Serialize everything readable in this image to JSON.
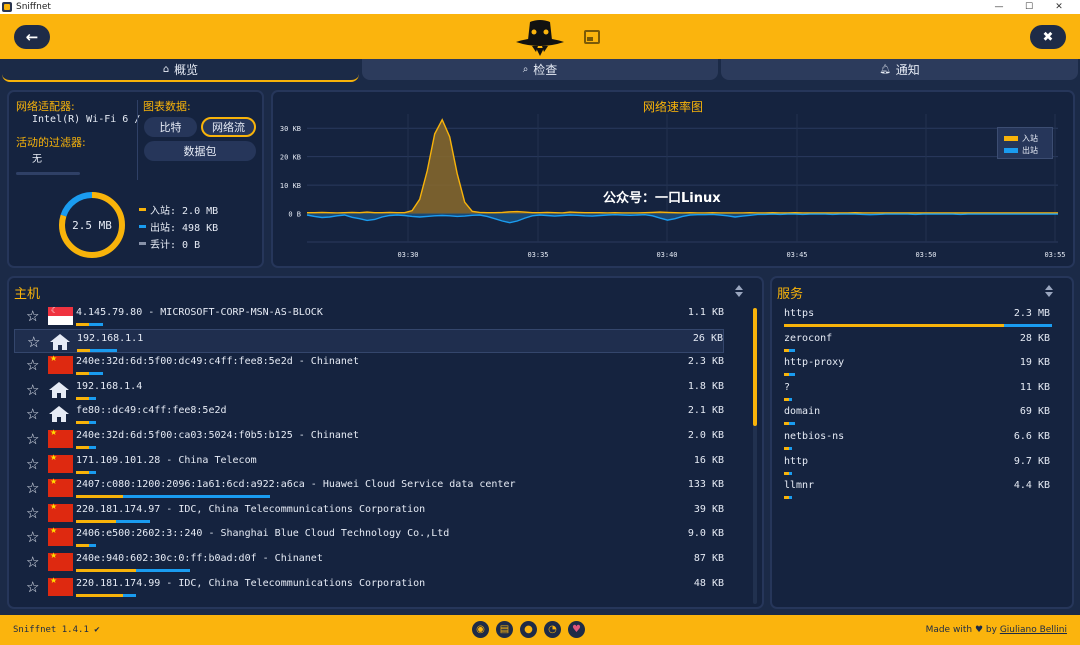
{
  "window": {
    "title": "Sniffnet",
    "controls": [
      "—",
      "☐",
      "✕"
    ]
  },
  "tabs": [
    {
      "label": "概览",
      "icon": "house-icon"
    },
    {
      "label": "检查",
      "icon": "search-icon"
    },
    {
      "label": "通知",
      "icon": "bell-icon"
    }
  ],
  "overview": {
    "adapter_label": "网络适配器:",
    "adapter_value": "Intel(R) Wi-Fi 6 /",
    "filter_label": "活动的过滤器:",
    "filter_value": "无",
    "chart_data_label": "图表数据:",
    "btn_bits": "比特",
    "btn_traffic": "网络流",
    "btn_packets": "数据包",
    "donut_total": "2.5 MB",
    "legend_in": "入站: 2.0 MB",
    "legend_out": "出站: 498 KB",
    "legend_dropped": "丢计: 0 B",
    "donut_fraction_in": 0.8
  },
  "chart_data": {
    "type": "area",
    "title": "网络速率图",
    "x_ticks": [
      "03:30",
      "03:35",
      "03:40",
      "03:45",
      "03:50",
      "03:55"
    ],
    "y_ticks": [
      "30 KB",
      "20 KB",
      "10 KB",
      "0 B"
    ],
    "ylim": [
      -10,
      35
    ],
    "series": [
      {
        "name": "入站",
        "color": "#f8b30a",
        "values": [
          0.3,
          0.3,
          0.4,
          0.3,
          0.2,
          0.3,
          0.4,
          0.3,
          0.5,
          0.3,
          0.3,
          0.4,
          0.3,
          0.3,
          1,
          5,
          15,
          28,
          33,
          27,
          14,
          4,
          0.8,
          0.4,
          0.3,
          0.3,
          0.4,
          0.6,
          0.7,
          0.5,
          0.3,
          0.3,
          0.4,
          0.3,
          0.2,
          0.5,
          0.4,
          0.3,
          0.3,
          0.3,
          0.2,
          0.3,
          0.2,
          0.2,
          0.2,
          0.3,
          0.4,
          0.5,
          0.4,
          0.3,
          0.2,
          0.3,
          0.2,
          0.2,
          0.3,
          0.2,
          0.2,
          0.2,
          0.2,
          0.3,
          0.2,
          0.2,
          0.3,
          0.2,
          0.2,
          0.3,
          0.2,
          0.2,
          0.2,
          0.2,
          0.2,
          0.2,
          0.2,
          0.3,
          0.2,
          0.2,
          0.2,
          0.2,
          0.2,
          0.2,
          0.2,
          0.2,
          0.2,
          0.2,
          0.2,
          0.2,
          0.2,
          0.2,
          0.2,
          0.2,
          0.2,
          0.2,
          0.2,
          0.2,
          0.2,
          0.2,
          0.2,
          0.2,
          0.2,
          0.2,
          0.2
        ]
      },
      {
        "name": "出站",
        "color": "#1a9cf0",
        "values": [
          -0.5,
          -1,
          -1.4,
          -1.2,
          -0.8,
          -0.5,
          -1.3,
          -1.8,
          -2.4,
          -2.1,
          -1.2,
          -0.7,
          -0.5,
          -0.7,
          -1,
          -1.2,
          -1,
          -0.8,
          -0.7,
          -0.8,
          -1,
          -0.9,
          -0.6,
          -0.5,
          -1,
          -1.8,
          -2.6,
          -3.2,
          -2.6,
          -1.6,
          -0.8,
          -0.5,
          -0.7,
          -0.9,
          -0.7,
          -0.5,
          -0.6,
          -0.8,
          -0.9,
          -0.7,
          -0.5,
          -0.4,
          -0.5,
          -0.6,
          -0.5,
          -0.4,
          -0.8,
          -1.6,
          -2.3,
          -1.8,
          -1,
          -0.5,
          -0.4,
          -0.4,
          -0.3,
          -0.5,
          -0.8,
          -1.2,
          -0.9,
          -0.6,
          -0.3,
          -0.3,
          -0.2,
          -0.3,
          -0.2,
          -0.2,
          -0.3,
          -0.2,
          -0.2,
          -0.2,
          -0.3,
          -0.2,
          -0.2,
          -0.2,
          -0.3,
          -0.4,
          -0.3,
          -0.2,
          -0.2,
          -0.2,
          -0.2,
          -0.3,
          -0.2,
          -0.2,
          -0.2,
          -0.2,
          -0.2,
          -0.3,
          -0.2,
          -0.2,
          -0.2,
          -0.2,
          -0.2,
          -0.2,
          -0.2,
          -0.2,
          -0.2,
          -0.2,
          -0.2,
          -0.2,
          -0.2
        ]
      }
    ],
    "legend": {
      "position": "top-right"
    },
    "grid": true
  },
  "watermark": "公众号：一口Linux",
  "hosts": {
    "title": "主机",
    "rows": [
      {
        "flag": "sg",
        "text": "4.145.79.80 - MICROSOFT-CORP-MSN-AS-BLOCK",
        "size": "1.1 KB",
        "in_frac": 0.02,
        "out_frac": 0.02,
        "highlight": false
      },
      {
        "flag": "home",
        "text": "192.168.1.1",
        "size": "26 KB",
        "in_frac": 0.02,
        "out_frac": 0.04,
        "highlight": true
      },
      {
        "flag": "cn",
        "text": "240e:32d:6d:5f00:dc49:c4ff:fee8:5e2d - Chinanet",
        "size": "2.3 KB",
        "in_frac": 0.02,
        "out_frac": 0.02,
        "highlight": false
      },
      {
        "flag": "home",
        "text": "192.168.1.4",
        "size": "1.8 KB",
        "in_frac": 0.02,
        "out_frac": 0.01,
        "highlight": false
      },
      {
        "flag": "home",
        "text": "fe80::dc49:c4ff:fee8:5e2d",
        "size": "2.1 KB",
        "in_frac": 0.02,
        "out_frac": 0.01,
        "highlight": false
      },
      {
        "flag": "cn",
        "text": "240e:32d:6d:5f00:ca03:5024:f0b5:b125 - Chinanet",
        "size": "2.0 KB",
        "in_frac": 0.02,
        "out_frac": 0.01,
        "highlight": false
      },
      {
        "flag": "cn",
        "text": "171.109.101.28 - China Telecom",
        "size": "16 KB",
        "in_frac": 0.02,
        "out_frac": 0.01,
        "highlight": false
      },
      {
        "flag": "cn",
        "text": "2407:c080:1200:2096:1a61:6cd:a922:a6ca - Huawei Cloud Service data center",
        "size": "133 KB",
        "in_frac": 0.07,
        "out_frac": 0.22,
        "highlight": false
      },
      {
        "flag": "cn",
        "text": "220.181.174.97 - IDC, China Telecommunications Corporation",
        "size": "39 KB",
        "in_frac": 0.06,
        "out_frac": 0.05,
        "highlight": false
      },
      {
        "flag": "cn",
        "text": "2406:e500:2602:3::240 - Shanghai Blue Cloud Technology Co.,Ltd",
        "size": "9.0 KB",
        "in_frac": 0.02,
        "out_frac": 0.01,
        "highlight": false
      },
      {
        "flag": "cn",
        "text": "240e:940:602:30c:0:ff:b0ad:d0f - Chinanet",
        "size": "87 KB",
        "in_frac": 0.09,
        "out_frac": 0.08,
        "highlight": false
      },
      {
        "flag": "cn",
        "text": "220.181.174.99 - IDC, China Telecommunications Corporation",
        "size": "48 KB",
        "in_frac": 0.07,
        "out_frac": 0.02,
        "highlight": false
      }
    ]
  },
  "services": {
    "title": "服务",
    "rows": [
      {
        "name": "https",
        "size": "2.3 MB",
        "in_frac": 0.82,
        "out_frac": 0.18
      },
      {
        "name": "zeroconf",
        "size": "28 KB",
        "in_frac": 0.02,
        "out_frac": 0.02
      },
      {
        "name": "http-proxy",
        "size": "19 KB",
        "in_frac": 0.02,
        "out_frac": 0.02
      },
      {
        "name": "?",
        "size": "11 KB",
        "in_frac": 0.02,
        "out_frac": 0.01
      },
      {
        "name": "domain",
        "size": "69 KB",
        "in_frac": 0.02,
        "out_frac": 0.02
      },
      {
        "name": "netbios-ns",
        "size": "6.6 KB",
        "in_frac": 0.02,
        "out_frac": 0.01
      },
      {
        "name": "http",
        "size": "9.7 KB",
        "in_frac": 0.02,
        "out_frac": 0.01
      },
      {
        "name": "llmnr",
        "size": "4.4 KB",
        "in_frac": 0.02,
        "out_frac": 0.01
      }
    ]
  },
  "footer": {
    "version": "Sniffnet 1.4.1 ✔",
    "made_with": "Made with",
    "by": "by",
    "author": "Giuliano Bellini",
    "icons": [
      "globe-icon",
      "book-icon",
      "github-icon",
      "rss-icon",
      "heart-icon"
    ]
  },
  "colors": {
    "accent": "#f8b30a",
    "outbound": "#1a9cf0",
    "background": "#1b2a47"
  }
}
